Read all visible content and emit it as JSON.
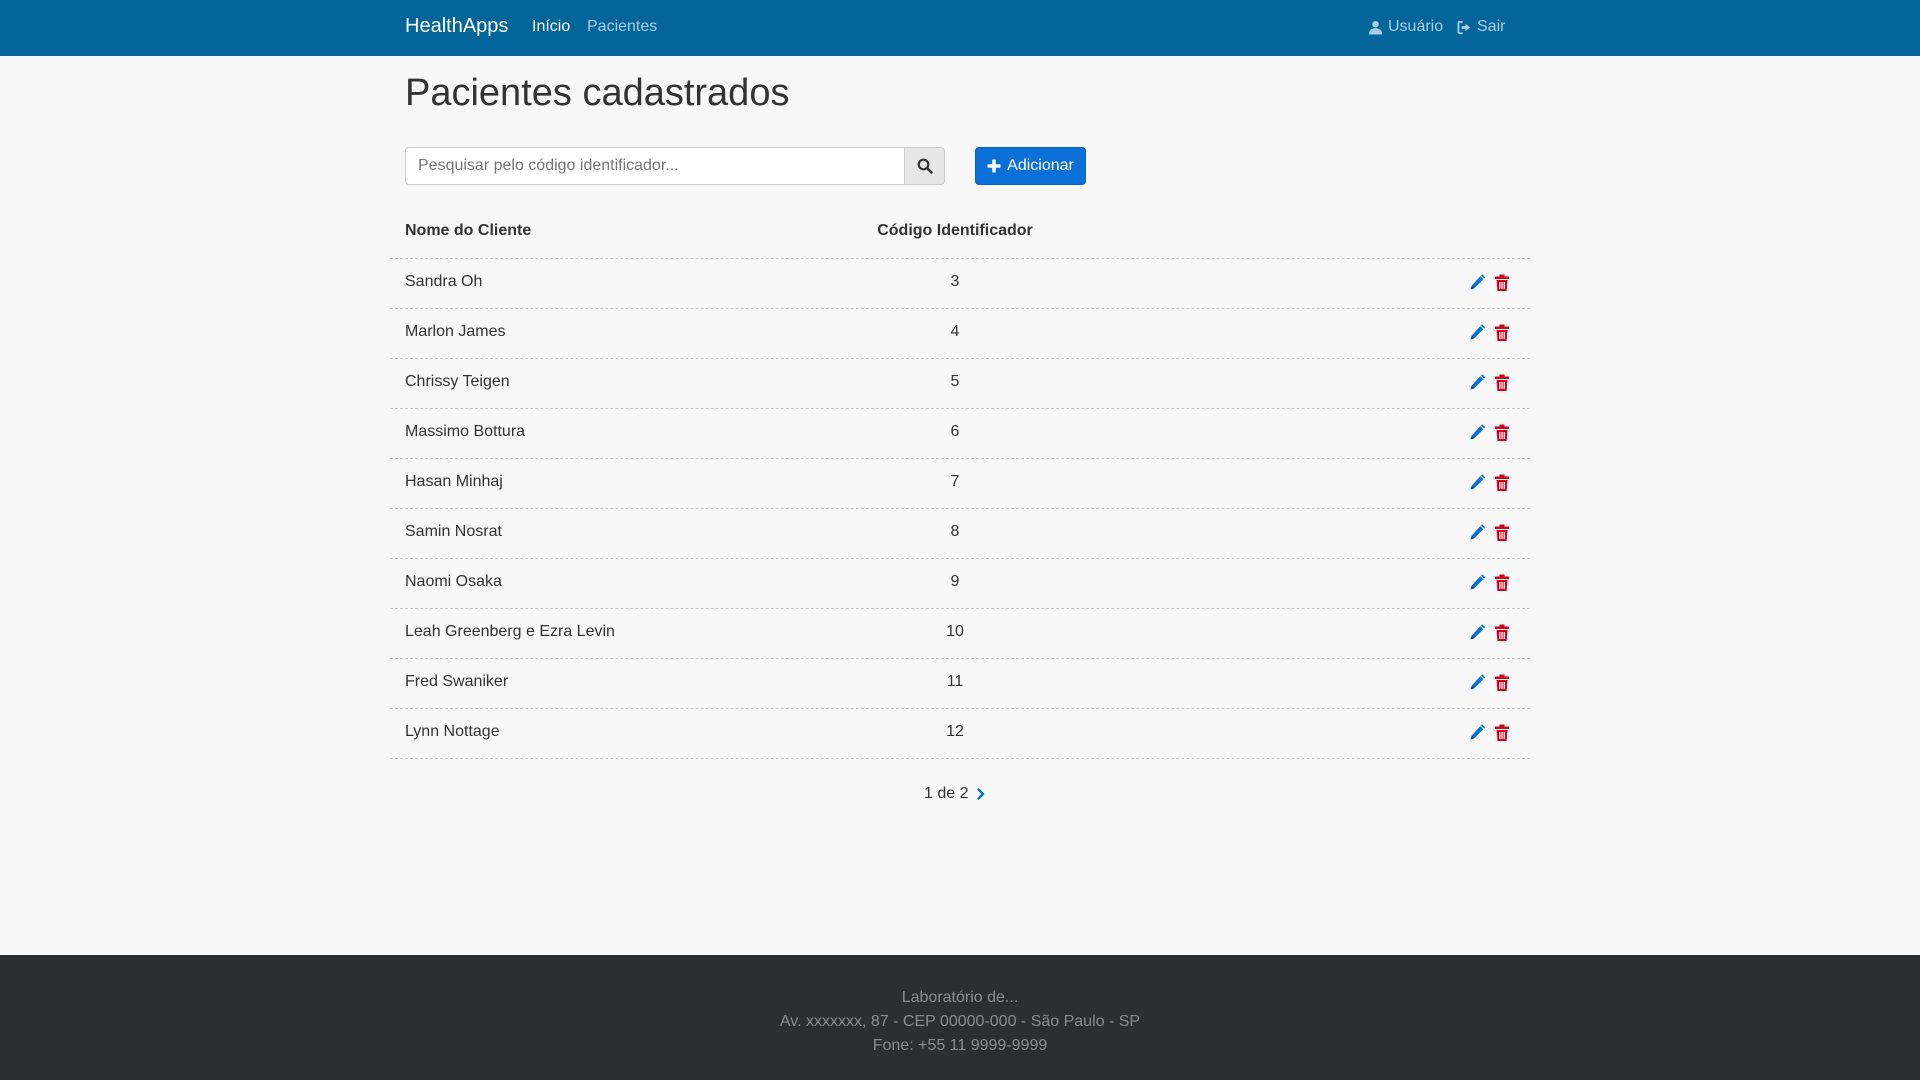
{
  "navbar": {
    "brand": "HealthApps",
    "links": [
      {
        "label": "Início",
        "active": true
      },
      {
        "label": "Pacientes",
        "active": false
      }
    ],
    "user_label": "Usuário",
    "logout_label": "Sair",
    "background_color": "#04659a"
  },
  "page": {
    "title": "Pacientes cadastrados"
  },
  "search": {
    "placeholder": "Pesquisar pelo código identificador...",
    "value": ""
  },
  "add_button": {
    "label": "Adicionar",
    "color": "#0a6fd6"
  },
  "table": {
    "columns": [
      "Nome do Cliente",
      "Código Identificador"
    ],
    "rows": [
      {
        "name": "Sandra Oh",
        "code": "3"
      },
      {
        "name": "Marlon James",
        "code": "4"
      },
      {
        "name": "Chrissy Teigen",
        "code": "5"
      },
      {
        "name": "Massimo Bottura",
        "code": "6"
      },
      {
        "name": "Hasan Minhaj",
        "code": "7"
      },
      {
        "name": "Samin Nosrat",
        "code": "8"
      },
      {
        "name": "Naomi Osaka",
        "code": "9"
      },
      {
        "name": "Leah Greenberg e Ezra Levin",
        "code": "10"
      },
      {
        "name": "Fred Swaniker",
        "code": "11"
      },
      {
        "name": "Lynn Nottage",
        "code": "12"
      }
    ],
    "edit_icon": "pencil-icon",
    "delete_icon": "trash-icon",
    "edit_color": "#0a6fd6",
    "delete_color": "#d0021b"
  },
  "pagination": {
    "label": "1 de 2"
  },
  "footer": {
    "lines": [
      "Laboratório de...",
      "Av. xxxxxxx, 87 - CEP 00000-000 - São Paulo - SP",
      "Fone: +55 11 9999-9999"
    ]
  }
}
